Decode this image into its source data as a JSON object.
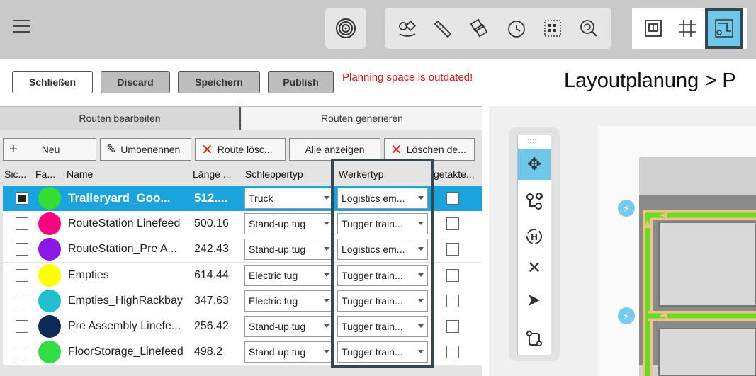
{
  "toolbar": {
    "menu_icon": "hamburger-menu-icon",
    "group1_icons": [
      "target-rings-icon"
    ],
    "group2_icons": [
      "shapes-route-icon",
      "ruler-pencil-icon",
      "layers-rotate-icon",
      "clock-icon",
      "grid-select-icon",
      "zoom-refresh-icon"
    ],
    "group3_icons": [
      "frame-icon",
      "grid-icon",
      "route-layout-icon"
    ],
    "accent_color": "#6fc7ea"
  },
  "actions": {
    "close_label": "Schließen",
    "discard_label": "Discard",
    "save_label": "Speichern",
    "publish_label": "Publish",
    "warning_text": "Planning space is outdated!",
    "breadcrumb": "Layoutplanung > P"
  },
  "tabs": [
    {
      "label": "Routen bearbeiten"
    },
    {
      "label": "Routen generieren"
    }
  ],
  "route_toolbar": {
    "new_label": "Neu",
    "rename_label": "Umbenennen",
    "delete_route_label": "Route lösc...",
    "show_all_label": "Alle anzeigen",
    "delete_label": "Löschen de..."
  },
  "table": {
    "headers": [
      "Sic...",
      "Fa...",
      "Name",
      "Länge ...",
      "Schleppertyp",
      "Werkertyp",
      "getakte..."
    ],
    "rows": [
      {
        "checked": true,
        "color": "#33dd33",
        "name": "Traileryard_Goo...",
        "length": "512....",
        "tug": "Truck",
        "worker": "Logistics em...",
        "clocked": false,
        "selected": true
      },
      {
        "checked": false,
        "color": "#ff007f",
        "name": "RouteStation Linefeed",
        "length": "500.16",
        "tug": "Stand-up tug",
        "worker": "Tugger train...",
        "clocked": false,
        "selected": false
      },
      {
        "checked": false,
        "color": "#8a18e8",
        "name": "RouteStation_Pre A...",
        "length": "242.43",
        "tug": "Stand-up tug",
        "worker": "Logistics em...",
        "clocked": false,
        "selected": false
      },
      {
        "checked": false,
        "color": "#ffff00",
        "name": "Empties",
        "length": "614.44",
        "tug": "Electric tug",
        "worker": "Tugger train...",
        "clocked": false,
        "selected": false
      },
      {
        "checked": false,
        "color": "#1fbfcf",
        "name": "Empties_HighRackbay",
        "length": "347.63",
        "tug": "Electric tug",
        "worker": "Tugger train...",
        "clocked": false,
        "selected": false
      },
      {
        "checked": false,
        "color": "#0d2b55",
        "name": "Pre Assembly Linefe...",
        "length": "256.42",
        "tug": "Stand-up tug",
        "worker": "Tugger train...",
        "clocked": false,
        "selected": false
      },
      {
        "checked": false,
        "color": "#33dd44",
        "name": "FloorStorage_Linefeed",
        "length": "498.2",
        "tug": "Stand-up tug",
        "worker": "Tugger train...",
        "clocked": false,
        "selected": false
      }
    ]
  },
  "side_tools": [
    "move-arrows-icon",
    "add-node-icon",
    "hub-rotate-icon",
    "cut-icon",
    "direction-arrow-icon",
    "route-path-icon"
  ]
}
